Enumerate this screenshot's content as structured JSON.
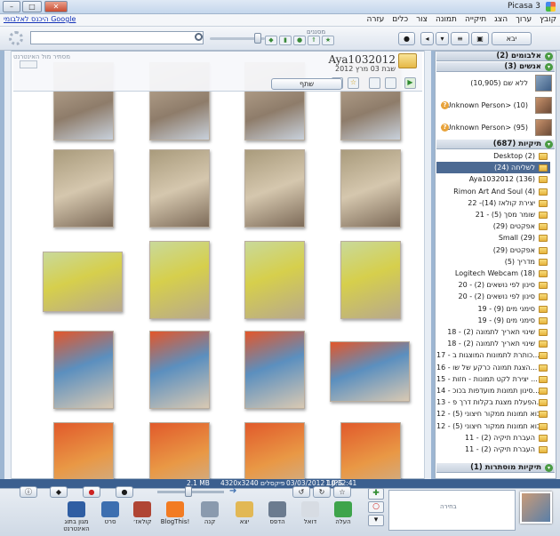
{
  "window": {
    "title": "Picasa 3"
  },
  "menu": {
    "items": [
      "קובץ",
      "ערוך",
      "הצג",
      "תיקייה",
      "תמונה",
      "צור",
      "כלים",
      "עזרה"
    ],
    "google_link": "היכנס לאלבומי Google"
  },
  "toolbar": {
    "import_label": "יבא",
    "filters_label": "מסננים",
    "search_placeholder": ""
  },
  "right_panel": {
    "albums_header": "אלבומים (2)",
    "people_header": "אנשים (3)",
    "people": [
      {
        "label": "ללא שם (10,905)",
        "warn": false
      },
      {
        "label": "<Unknown Person> (10)",
        "warn": true
      },
      {
        "label": "<Unknown Person> (95)",
        "warn": true
      }
    ],
    "folders_header": "תיקיות (687)",
    "folders": [
      "Desktop (2)",
      "לשליחה (24)",
      "Aya1032012 (136)",
      "Rimon Art And Soul (4)",
      "22 -יצירת קולאז (14)",
      "21 - שומר מסך (5)",
      "אפקטים (29)",
      "Small (29)",
      "אפקטים (29)",
      "מדריך (5)",
      "Logitech Webcam (18)",
      "20 - סינון לפי נושאים (2)",
      "20 - סינון לפי נושאים (2)",
      "19 - סימני מים (9)",
      "19 - סימני מים (9)",
      "18 - שינוי תאריך לתמונה (2)",
      "18 - שינוי תאריך לתמונה (2)",
      "17 - כותרת לתמונות המוצגות ב...",
      "16 - הצגת תמונה כרקע של שו...",
      "15 - יצירת לקט תמונות - חזות ...",
      "14 - סינון תמונות מועדפות בכוכ...",
      "13 - הפעלת מצגת בקלות דרך פ...",
      "12 - יבוא תמונות ממקור חיצוני (5)",
      "12 - יבוא תמונות ממקור חיצוני (5)",
      "11 - העברת תיקיה (2)",
      "11 - העברת תיקיה (2)"
    ],
    "selected_folder_index": 1,
    "hidden_header": "תיקיות מוסתרות (1)"
  },
  "folder": {
    "title": "Aya1032012",
    "date": "שבת 03 מרץ 2012",
    "share_label": "שתף",
    "map_label": "מסתיר מול האינטרנט"
  },
  "status": {
    "filename": "1.JPG",
    "datetime": "03/03/2012 10:32:41",
    "dimensions": "4320x3240 פיקסלים",
    "size": "2.1 MB"
  },
  "actions": [
    {
      "label": "העלה",
      "icon": "upload-arrow-icon",
      "color": "#3ea44b"
    },
    {
      "label": "דואל",
      "icon": "envelope-icon",
      "color": "#d7dce3"
    },
    {
      "label": "הדפס",
      "icon": "printer-icon",
      "color": "#6b7b8f"
    },
    {
      "label": "יצא",
      "icon": "folder-export-icon",
      "color": "#e2b855"
    },
    {
      "label": "קנה",
      "icon": "shop-icon",
      "color": "#8a9aae"
    },
    {
      "label": "BlogThis!",
      "icon": "blogger-icon",
      "color": "#f27b22"
    },
    {
      "label": "קולאז׳",
      "icon": "collage-icon",
      "color": "#b04534"
    },
    {
      "label": "סרט",
      "icon": "film-icon",
      "color": "#3d6fb0"
    },
    {
      "label": "מגון בתוג האינטרנט",
      "icon": "google-earth-icon",
      "color": "#2f5ea3"
    }
  ],
  "held": {
    "label": "בחירה"
  }
}
